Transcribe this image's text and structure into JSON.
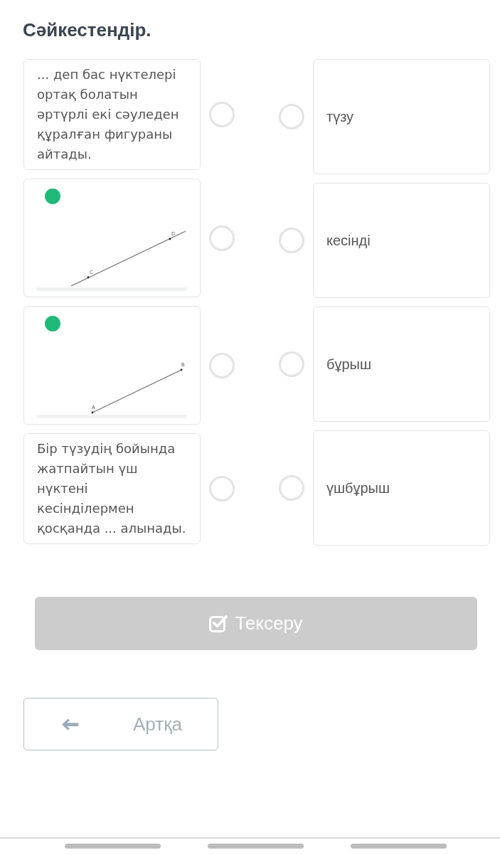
{
  "title": "Сәйкестендір.",
  "left_items": [
    {
      "kind": "text",
      "text": "... деп бас нүктелері ортақ болатын әртүрлі екі сәуледен құралған фигураны айтады.",
      "selected": false
    },
    {
      "kind": "figure",
      "extended": true,
      "points": [
        "C",
        "D"
      ],
      "selected": false
    },
    {
      "kind": "figure",
      "extended": false,
      "points": [
        "A",
        "B"
      ],
      "selected": false
    },
    {
      "kind": "text",
      "text": "Бір түзудің бойында жатпайтын үш нүктені кесінділермен қосқанда ... алынады.",
      "selected": false
    }
  ],
  "right_items": [
    {
      "text": "түзу",
      "selected": false
    },
    {
      "text": "кесінді",
      "selected": false
    },
    {
      "text": "бұрыш",
      "selected": false
    },
    {
      "text": "үшбұрыш",
      "selected": false
    }
  ],
  "check_button": {
    "label": "Тексеру",
    "disabled": true
  },
  "back_button": {
    "label": "Артқа"
  }
}
